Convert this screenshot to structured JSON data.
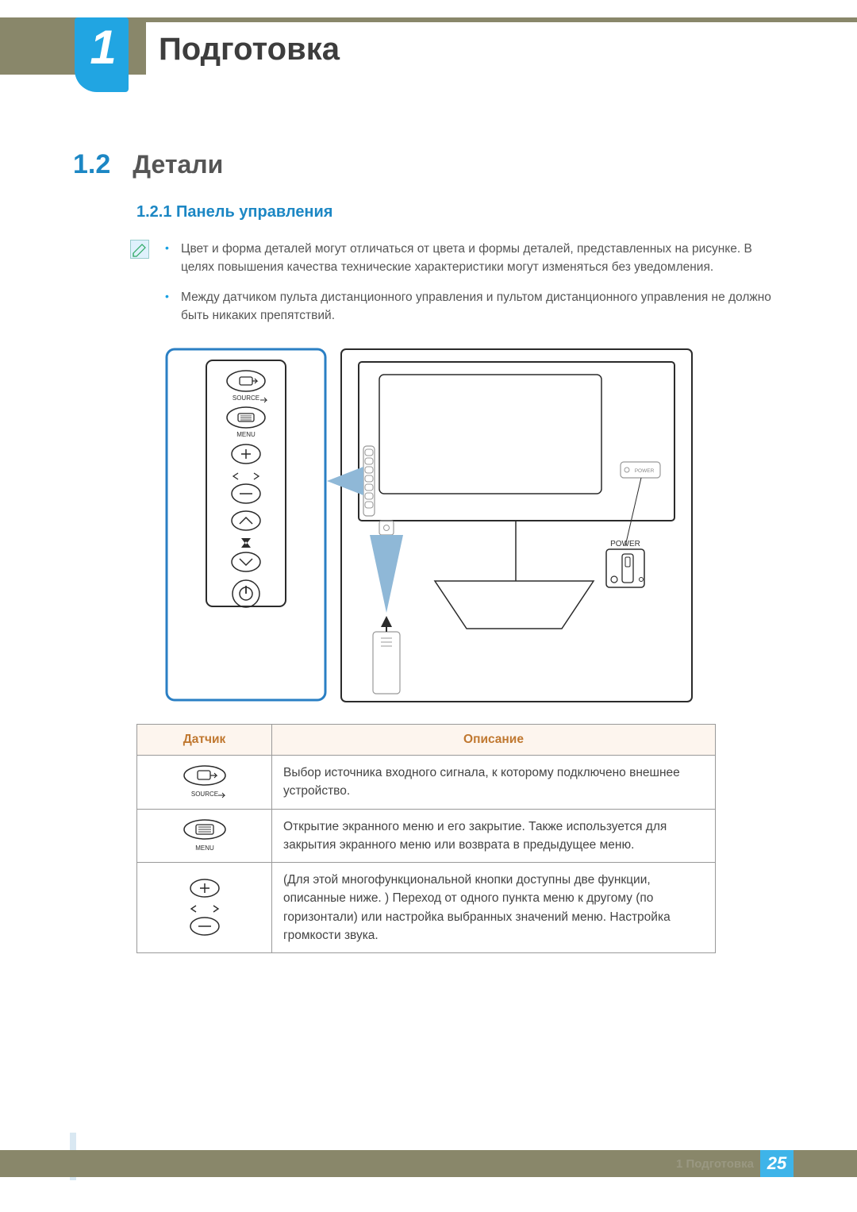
{
  "chapter": {
    "number": "1",
    "title": "Подготовка"
  },
  "section": {
    "number": "1.2",
    "title": "Детали"
  },
  "subsection": {
    "full": "1.2.1 Панель управления"
  },
  "notes": {
    "items": [
      "Цвет и форма деталей могут отличаться от цвета и формы деталей, представленных на рисунке. В целях повышения качества технические характеристики могут изменяться без уведомления.",
      "Между датчиком пульта дистанционного управления и пультом дистанционного управления не должно быть никаких препятствий."
    ]
  },
  "diagram_labels": {
    "source": "SOURCE",
    "menu": "MENU",
    "power": "POWER",
    "power_small": "POWER"
  },
  "table": {
    "headers": {
      "sensor": "Датчик",
      "description": "Описание"
    },
    "rows": [
      {
        "icon_label": "SOURCE",
        "description": "Выбор источника входного сигнала, к которому подключено внешнее устройство."
      },
      {
        "icon_label": "MENU",
        "description": "Открытие экранного меню и его закрытие. Также используется для закрытия экранного меню или возврата в предыдущее меню."
      },
      {
        "icon_label": "",
        "description": "(Для этой многофункциональной кнопки доступны две функции, описанные ниже. ) Переход от одного пункта меню к другому (по горизонтали) или настройка выбранных значений меню. Настройка громкости звука."
      }
    ]
  },
  "footer": {
    "label": "1 Подготовка",
    "page": "25"
  }
}
